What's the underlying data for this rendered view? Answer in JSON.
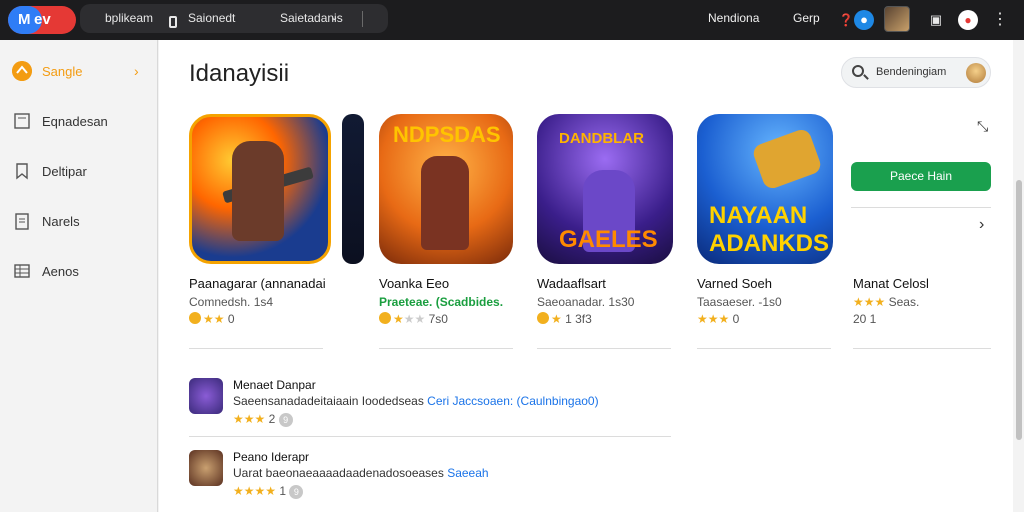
{
  "topbar": {
    "logo_mark": "M",
    "logo_text": "ev",
    "app_name": "bplikeam",
    "search_scope": "Saionedt",
    "right_tab": "Saietadanis",
    "account_label": "Nendiona",
    "menu_label": "Gerp",
    "icons": [
      "question-icon",
      "avatar-icon",
      "calendar-icon",
      "notification-icon",
      "more-icon"
    ]
  },
  "sidebar": {
    "items": [
      {
        "label": "Sangle",
        "icon": "home-icon",
        "active": true
      },
      {
        "label": "Eqnadesan",
        "icon": "document-icon",
        "active": false
      },
      {
        "label": "Deltipar",
        "icon": "bookmark-icon",
        "active": false
      },
      {
        "label": "Narels",
        "icon": "clipboard-icon",
        "active": false
      },
      {
        "label": "Aenos",
        "icon": "list-icon",
        "active": false
      }
    ],
    "accent": "#f39c12"
  },
  "main": {
    "title": "Idanayisii",
    "search": {
      "label": "Bendeningiam"
    },
    "cards": [
      {
        "title": "Paanagarar (annanadai",
        "sub": "Comnedsh. 1s4",
        "rating_text": "0"
      },
      {
        "title": "Voanka Eeo",
        "sub": "Praeteae. (Scadbides.",
        "rating_text": "7s0"
      },
      {
        "title": "Wadaaflsart",
        "sub": "Saeoanadar. 1s30",
        "rating_text": "1 3f3"
      },
      {
        "title": "Varned Soeh",
        "sub": "Taasaeser. -1s0",
        "rating_text": "0"
      },
      {
        "title": "Manat Celosl",
        "sub": "Seas.",
        "rating_text": "20   1"
      }
    ],
    "card_art_text": {
      "c3": "NDPSDAS",
      "c4_top": "DANDBLAR",
      "c4_bottom": "GAELES",
      "c5": "NAYAAN ADANKDS"
    },
    "install_label": "Paece Hain",
    "list": [
      {
        "title": "Menaet Danpar",
        "desc": "Saeensanadadeitaiaain Ioodedseas",
        "link": "Ceri Jaccsoaen: (Caulnbingao0)",
        "rating": "2",
        "badge": "9"
      },
      {
        "title": "Peano Iderapr",
        "desc": "Uarat baeonaeaaaadaadenadosoeases",
        "link": "Saeeah",
        "rating": "1",
        "badge": "9"
      }
    ],
    "colors": {
      "install": "#1aa04e",
      "link": "#1a73e8",
      "star": "#f2b01e"
    }
  }
}
